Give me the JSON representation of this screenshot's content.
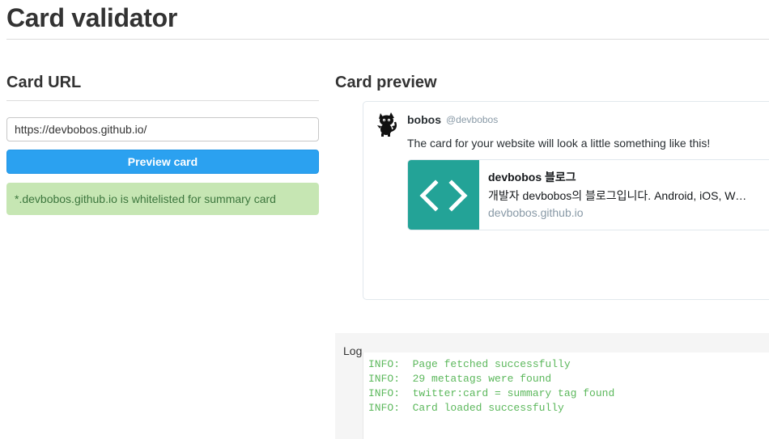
{
  "page": {
    "title": "Card validator"
  },
  "left": {
    "heading": "Card URL",
    "url_input": {
      "value": "https://devbobos.github.io/"
    },
    "preview_button": "Preview card",
    "status_message": "*.devbobos.github.io is whitelisted for summary card"
  },
  "right": {
    "heading": "Card preview",
    "tweet": {
      "user_name": "bobos",
      "user_handle": "@devbobos",
      "text": "The card for your website will look a little something like this!",
      "avatar_icon": "black-cat-avatar-icon"
    },
    "card": {
      "thumbnail_icon": "code-brackets-icon",
      "thumbnail_color": "#23a397",
      "title": "devbobos 블로그",
      "description": "개발자 devbobos의 블로그입니다. Android, iOS, We…",
      "domain": "devbobos.github.io"
    }
  },
  "log": {
    "label": "Log",
    "lines": [
      "INFO:  Page fetched successfully",
      "INFO:  29 metatags were found",
      "INFO:  twitter:card = summary tag found",
      "INFO:  Card loaded successfully"
    ]
  },
  "colors": {
    "button": "#2ba1f0",
    "success_bg": "#c6e6b3",
    "success_text": "#3c763d",
    "log_text": "#5cb85c"
  }
}
